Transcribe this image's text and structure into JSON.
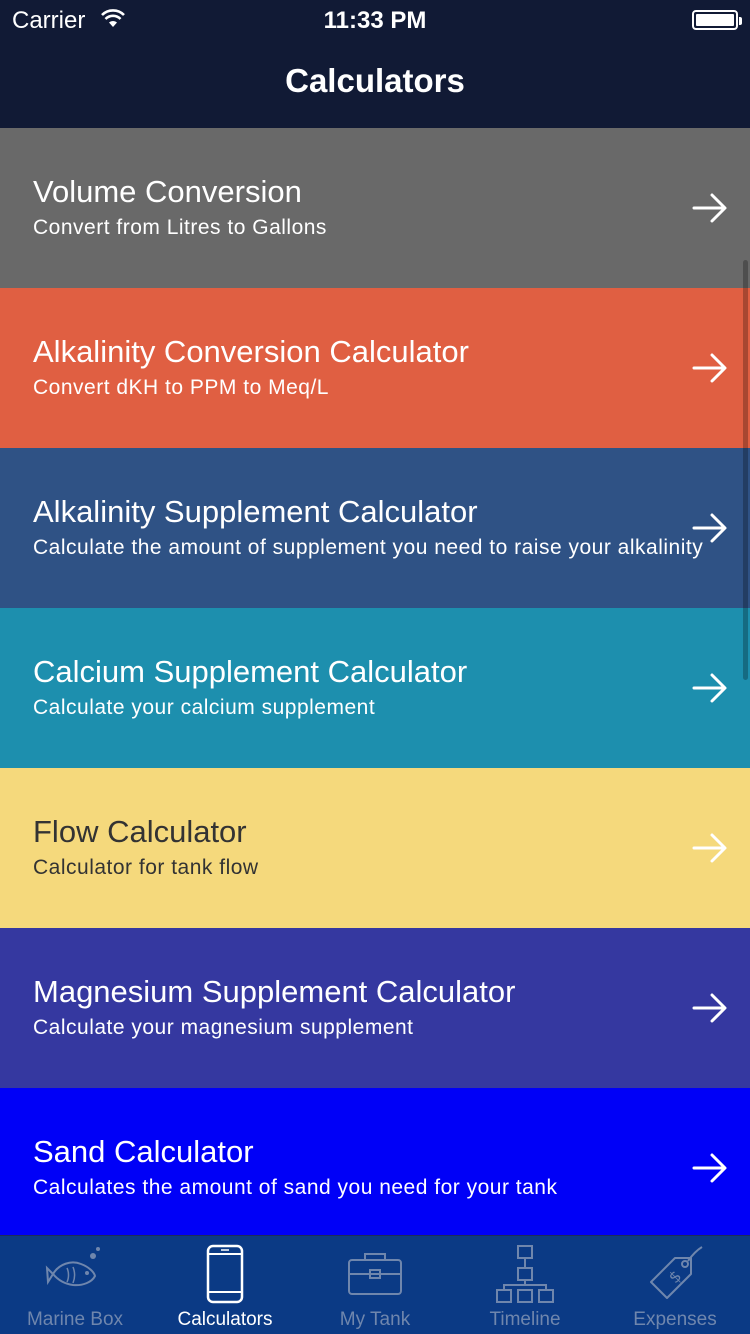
{
  "status_bar": {
    "carrier": "Carrier",
    "time": "11:33 PM"
  },
  "nav": {
    "title": "Calculators"
  },
  "rows": [
    {
      "title": "Volume Conversion",
      "subtitle": "Convert from Litres to Gallons",
      "bg": "#696969",
      "text_color": "#ffffff"
    },
    {
      "title": "Alkalinity Conversion Calculator",
      "subtitle": "Convert dKH to PPM to Meq/L",
      "bg": "#e05f42",
      "text_color": "#ffffff"
    },
    {
      "title": "Alkalinity Supplement Calculator",
      "subtitle": "Calculate the amount of supplement you need to raise your alkalinity",
      "bg": "#2f5285",
      "text_color": "#ffffff"
    },
    {
      "title": "Calcium Supplement Calculator",
      "subtitle": "Calculate your calcium supplement",
      "bg": "#1d8fae",
      "text_color": "#ffffff"
    },
    {
      "title": "Flow Calculator",
      "subtitle": "Calculator for tank flow",
      "bg": "#f5d97c",
      "text_color": "#333333"
    },
    {
      "title": "Magnesium Supplement Calculator",
      "subtitle": "Calculate your magnesium supplement",
      "bg": "#3538a0",
      "text_color": "#ffffff"
    },
    {
      "title": "Sand Calculator",
      "subtitle": "Calculates the amount of sand you need for your tank",
      "bg": "#0000f7",
      "text_color": "#ffffff"
    }
  ],
  "tabs": [
    {
      "label": "Marine Box",
      "icon": "fish-icon",
      "active": false
    },
    {
      "label": "Calculators",
      "icon": "phone-icon",
      "active": true
    },
    {
      "label": "My Tank",
      "icon": "toolbox-icon",
      "active": false
    },
    {
      "label": "Timeline",
      "icon": "hierarchy-icon",
      "active": false
    },
    {
      "label": "Expenses",
      "icon": "price-tag-icon",
      "active": false
    }
  ],
  "colors": {
    "nav_bg": "#111a35",
    "tab_bar_bg": "#0b3a85",
    "tab_inactive": "#6f86ad",
    "tab_active": "#ffffff"
  }
}
